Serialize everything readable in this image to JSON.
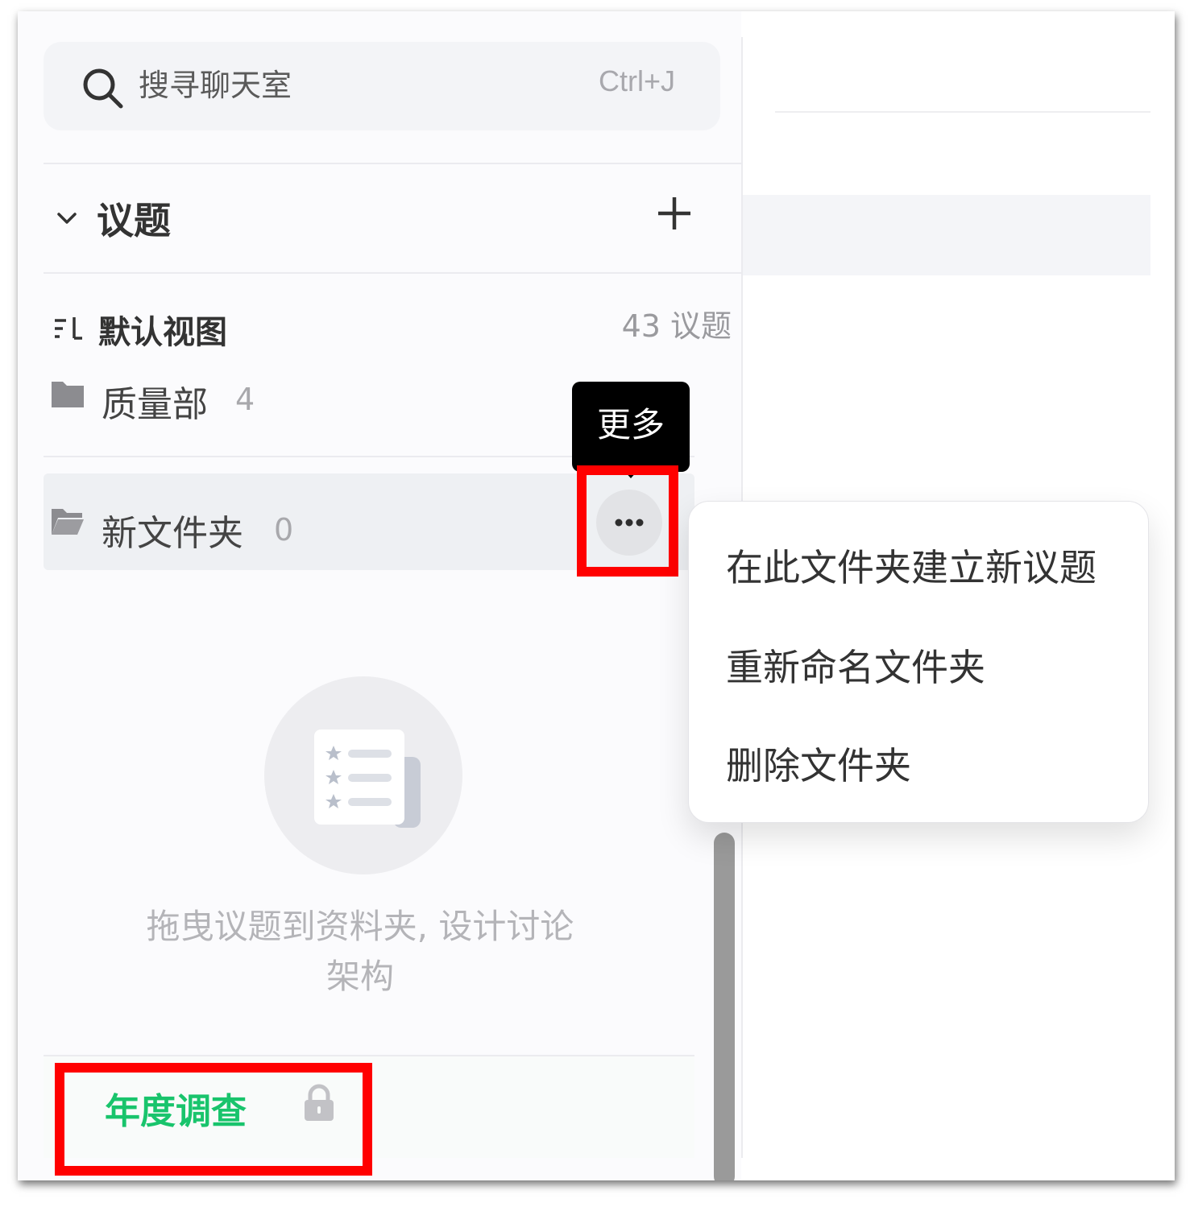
{
  "search": {
    "placeholder": "搜寻聊天室",
    "shortcut": "Ctrl+J",
    "icon": "search-icon"
  },
  "section": {
    "title": "议题",
    "collapse_icon": "chevron-down-icon",
    "add_icon": "plus-icon"
  },
  "view": {
    "label": "默认视图",
    "count": "43 议题",
    "icon": "sort-list-icon"
  },
  "folders": [
    {
      "name": "质量部",
      "count": "4",
      "icon": "folder-icon"
    },
    {
      "name": "新文件夹",
      "count": "0",
      "icon": "folder-open-icon"
    }
  ],
  "tooltip": {
    "text": "更多"
  },
  "more_button": {
    "icon": "more-horizontal-icon"
  },
  "menu": {
    "items": [
      "在此文件夹建立新议题",
      "重新命名文件夹",
      "删除文件夹"
    ]
  },
  "empty_state": {
    "line1": "拖曳议题到资料夹, 设计讨论",
    "line2": "架构"
  },
  "bottom_item": {
    "label": "年度调查",
    "icon": "lock-icon"
  },
  "colors": {
    "accent_green": "#19c46c",
    "highlight_red": "#ff0000",
    "tooltip_bg": "#000000"
  }
}
